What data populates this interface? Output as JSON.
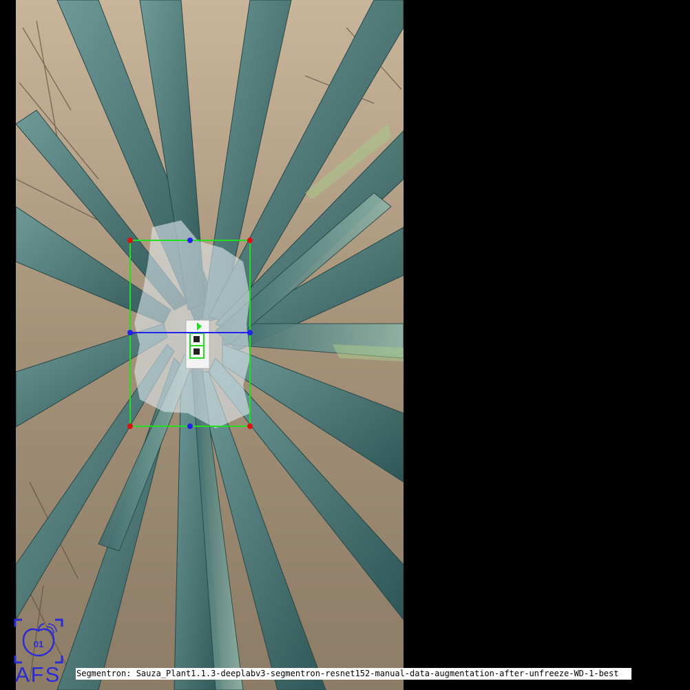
{
  "caption": "Segmentron: Sauza_Plant1.1.3-deeplabv3-segmentron-resnet152-manual-data-augmentation-after-unfreeze-WD-1-best",
  "logo": {
    "text": "AFS",
    "badge_text": "01",
    "color": "#2a2ad8"
  },
  "colors": {
    "bounding_box": "#22dd22",
    "corner_points": "#dd1111",
    "midpoints": "#2222ee",
    "width_line": "#2222ee",
    "segmentation_mask": "#dfe8ee",
    "background": "#000000"
  },
  "photo": {
    "subject": "agave-plant-top-view"
  }
}
